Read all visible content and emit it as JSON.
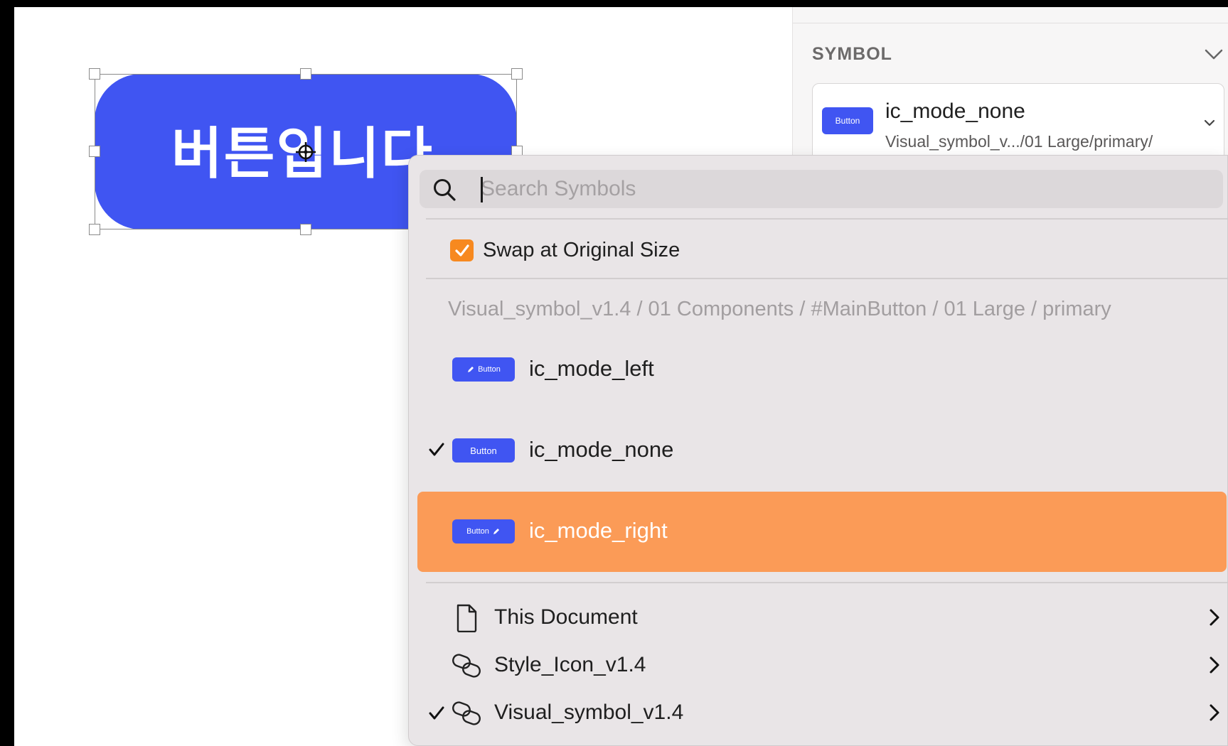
{
  "canvas": {
    "button_text": "버튼입니다",
    "button_color": "#4055f2"
  },
  "inspector": {
    "section_title": "SYMBOL",
    "current_symbol": {
      "thumb_label": "Button",
      "name": "ic_mode_none",
      "path": "Visual_symbol_v.../01 Large/primary/"
    }
  },
  "menu": {
    "search_placeholder": "Search Symbols",
    "swap_option": {
      "label": "Swap at Original Size",
      "checked": true
    },
    "breadcrumb": "Visual_symbol_v1.4 / 01 Components / #MainButton / 01 Large / primary",
    "items": [
      {
        "name": "ic_mode_left",
        "thumb_label": "Button",
        "thumb_icon": "pencil-left",
        "checked": false,
        "highlighted": false
      },
      {
        "name": "ic_mode_none",
        "thumb_label": "Button",
        "thumb_icon": "none",
        "checked": true,
        "highlighted": false
      },
      {
        "name": "ic_mode_right",
        "thumb_label": "Button",
        "thumb_icon": "pencil-right",
        "checked": false,
        "highlighted": true
      }
    ],
    "libraries": [
      {
        "name": "This Document",
        "icon": "document-icon",
        "checked": false
      },
      {
        "name": "Style_Icon_v1.4",
        "icon": "link-icon",
        "checked": false
      },
      {
        "name": "Visual_symbol_v1.4",
        "icon": "link-icon",
        "checked": true
      }
    ]
  },
  "colors": {
    "accent_orange": "#f7891f",
    "highlight_row": "#fb9b57",
    "button_blue": "#4055f2"
  }
}
